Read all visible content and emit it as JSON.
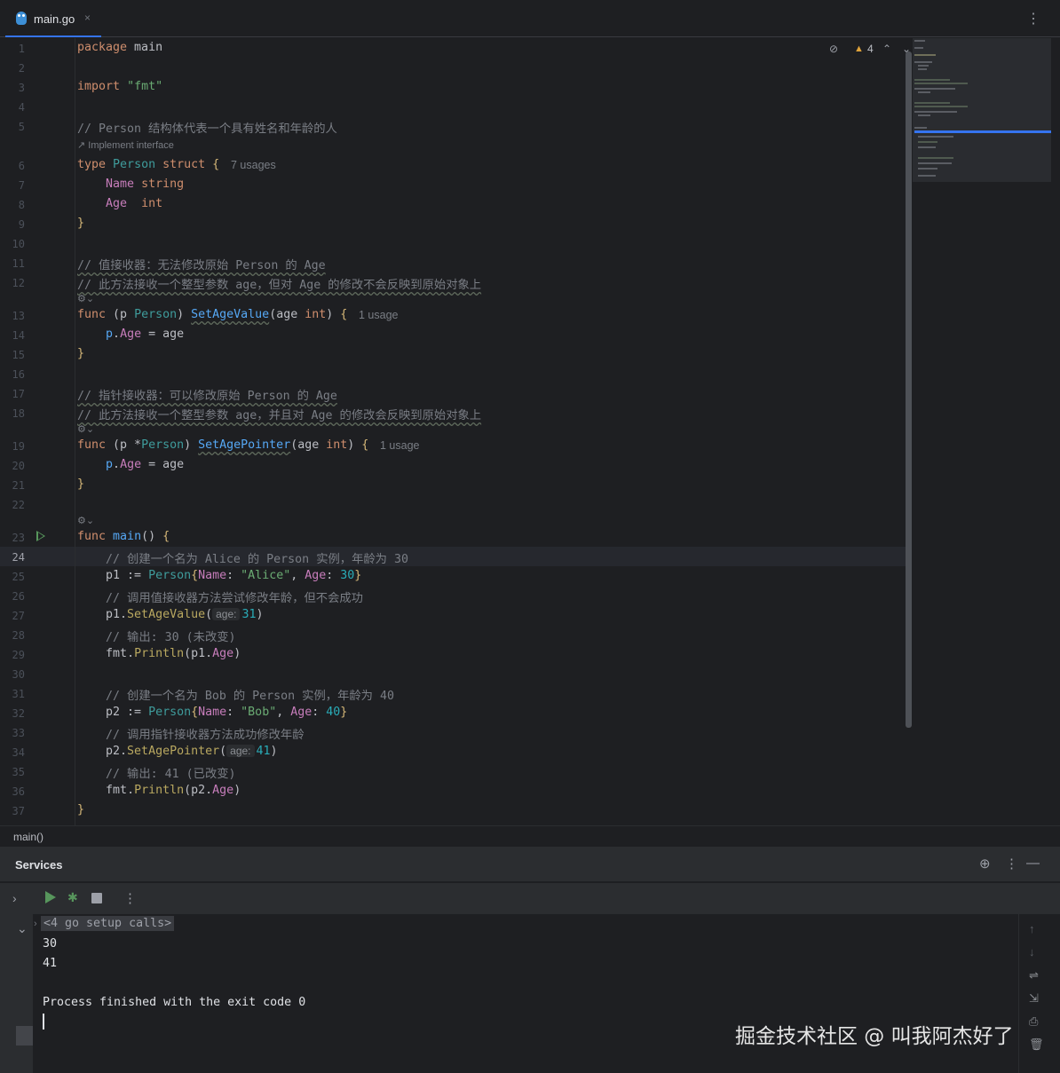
{
  "tab": {
    "file_name": "main.go",
    "close_glyph": "×",
    "gopher_icon": "gopher-icon"
  },
  "top_more": "⋮",
  "editor": {
    "current_line": 24,
    "line_count": 37,
    "problems": {
      "eye_glyph": "⊘",
      "warning_glyph": "▲",
      "warning_count": "4",
      "up": "⌃",
      "down": "⌄"
    },
    "lens": {
      "implement": "Implement interface",
      "usages_person": "7 usages",
      "usage_setagevalue": "1 usage",
      "usage_setagepointer": "1 usage"
    },
    "hints": {
      "age_param": "age:"
    }
  },
  "breadcrumb": "main()",
  "services": {
    "title": "Services",
    "console": {
      "setup_calls": "<4 go setup calls>",
      "lines": [
        "30",
        "41",
        "",
        "Process finished with the exit code 0"
      ]
    }
  },
  "watermark": "掘金技术社区 @ 叫我阿杰好了",
  "colors": {
    "accent": "#3574f0",
    "run": "#57965c",
    "keyword": "#cf8e6d",
    "string": "#6aab73",
    "number": "#2aacb8",
    "function": "#56a8f5",
    "comment": "#7a7e85"
  }
}
